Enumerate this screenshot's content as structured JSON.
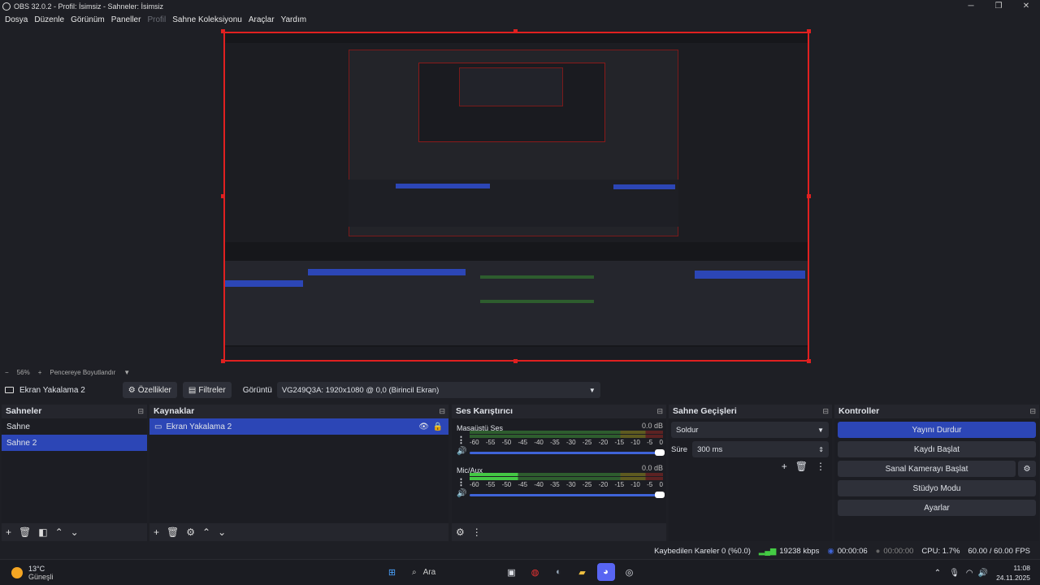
{
  "window": {
    "title": "OBS 32.0.2 - Profil: İsimsiz - Sahneler: İsimsiz"
  },
  "menu": [
    "Dosya",
    "Düzenle",
    "Görünüm",
    "Paneller",
    "Profil",
    "Sahne Koleksiyonu",
    "Araçlar",
    "Yardım"
  ],
  "zoom": {
    "minus": "−",
    "value": "56%",
    "plus": "+",
    "fit_label": "Pencereye Boyutlandır"
  },
  "source_toolbar": {
    "source_name": "Ekran Yakalama 2",
    "properties_label": "Özellikler",
    "filters_label": "Filtreler",
    "display_label": "Görüntü",
    "display_value": "VG249Q3A: 1920x1080 @ 0,0 (Birincil Ekran)"
  },
  "scenes": {
    "title": "Sahneler",
    "items": [
      "Sahne",
      "Sahne 2"
    ],
    "selected": 1
  },
  "sources": {
    "title": "Kaynaklar",
    "items": [
      "Ekran Yakalama 2"
    ]
  },
  "mixer": {
    "title": "Ses Karıştırıcı",
    "channels": [
      {
        "name": "Masaüstü Ses",
        "db": "0.0 dB",
        "level": 0.0
      },
      {
        "name": "Mic/Aux",
        "db": "0.0 dB",
        "level": 0.25
      }
    ],
    "ticks": [
      "-60",
      "-55",
      "-50",
      "-45",
      "-40",
      "-35",
      "-30",
      "-25",
      "-20",
      "-15",
      "-10",
      "-5",
      "0"
    ]
  },
  "transitions": {
    "title": "Sahne Geçişleri",
    "selected": "Soldur",
    "duration_label": "Süre",
    "duration_value": "300 ms"
  },
  "controls": {
    "title": "Kontroller",
    "stop_stream": "Yayını Durdur",
    "start_record": "Kaydı Başlat",
    "virtual_cam": "Sanal Kamerayı Başlat",
    "studio_mode": "Stüdyo Modu",
    "settings": "Ayarlar"
  },
  "status": {
    "dropped": "Kaybedilen Kareler 0 (%0.0)",
    "bitrate": "19238 kbps",
    "stream_time": "00:00:06",
    "rec_time": "00:00:00",
    "cpu": "CPU: 1.7%",
    "fps": "60.00 / 60.00 FPS"
  },
  "taskbar": {
    "temp": "13°C",
    "weather": "Güneşli",
    "search": "Ara",
    "time": "11:08",
    "date": "24.11.2025"
  },
  "colors": {
    "accent": "#2c46b6",
    "selection": "#e02020"
  }
}
